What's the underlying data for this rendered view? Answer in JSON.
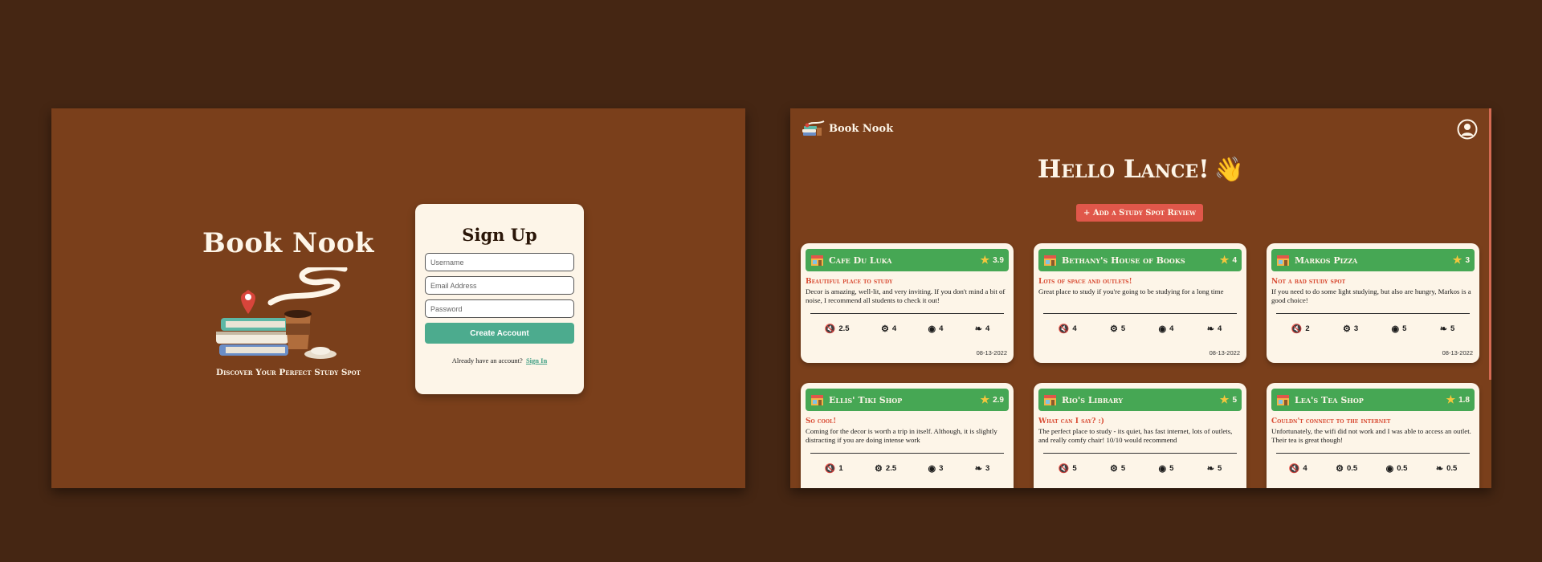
{
  "colors": {
    "background": "#452613",
    "screen": "#7a3f1b",
    "card": "#fdf5e8",
    "card_header": "#46a754",
    "accent_teal": "#4cab8e",
    "accent_red": "#e0574a",
    "star": "#f4c63d"
  },
  "signup_screen": {
    "brand_title": "Book Nook",
    "tagline": "Discover Your Perfect Study Spot",
    "illustration": "books-coffee-illustration",
    "form": {
      "title": "Sign Up",
      "username_placeholder": "Username",
      "email_placeholder": "Email Address",
      "password_placeholder": "Password",
      "submit_label": "Create Account",
      "already_text": "Already have an account?",
      "signin_link": "Sign In"
    }
  },
  "dashboard_screen": {
    "nav": {
      "brand": "Book Nook",
      "logo_icon": "book-nook-logo-icon",
      "profile_icon": "user-circle-icon"
    },
    "greeting": "Hello Lance!",
    "greeting_emoji": "👋",
    "add_button": "+ Add a Study Spot Review",
    "stat_icons": [
      "mute-icon",
      "outlet-icon",
      "wifi-icon",
      "leaf-icon"
    ],
    "cards": [
      {
        "name": "Cafe Du Luka",
        "rating": "3.9",
        "subtitle": "Beautiful place to study",
        "body": "Decor is amazing, well-lit, and very inviting. If you don't mind a bit of noise, I recommend all students to check it out!",
        "stats": [
          "2.5",
          "4",
          "4",
          "4"
        ],
        "date": "08-13-2022"
      },
      {
        "name": "Bethany's House of Books",
        "rating": "4",
        "subtitle": "Lots of space and outlets!",
        "body": "Great place to study if you're going to be studying for a long time",
        "stats": [
          "4",
          "5",
          "4",
          "4"
        ],
        "date": "08-13-2022"
      },
      {
        "name": "Markos Pizza",
        "rating": "3",
        "subtitle": "Not a bad study spot",
        "body": "If you need to do some light studying, but also are hungry, Markos is a good choice!",
        "stats": [
          "2",
          "3",
          "5",
          "5"
        ],
        "date": "08-13-2022"
      },
      {
        "name": "Ellis' Tiki Shop",
        "rating": "2.9",
        "subtitle": "So cool!",
        "body": "Coming for the decor is worth a trip in itself. Although, it is slightly distracting if you are doing intense work",
        "stats": [
          "1",
          "2.5",
          "3",
          "3"
        ],
        "date": ""
      },
      {
        "name": "Rio's Library",
        "rating": "5",
        "subtitle": "What can I say? :)",
        "body": "The perfect place to study - its quiet, has fast internet, lots of outlets, and really comfy chair! 10/10 would recommend",
        "stats": [
          "5",
          "5",
          "5",
          "5"
        ],
        "date": ""
      },
      {
        "name": "Lea's Tea Shop",
        "rating": "1.8",
        "subtitle": "Couldn't connect to the internet",
        "body": "Unfortunately, the wifi did not work and I was able to access an outlet. Their tea is great though!",
        "stats": [
          "4",
          "0.5",
          "0.5",
          "0.5"
        ],
        "date": ""
      }
    ]
  }
}
